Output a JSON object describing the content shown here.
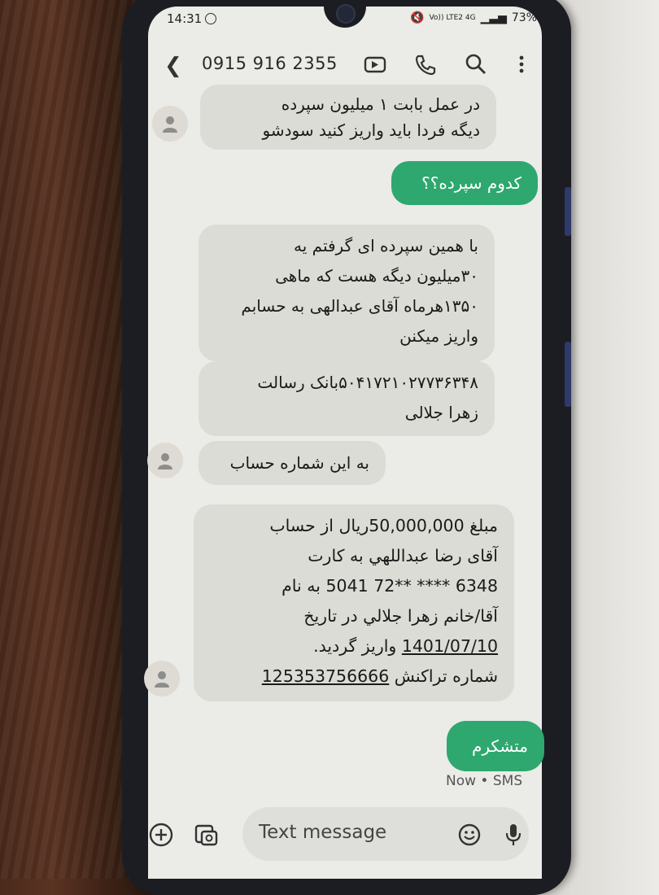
{
  "status_bar": {
    "time": "14:31",
    "network": "Vo)) LTE2 4G",
    "battery": "73%"
  },
  "header": {
    "contact": "0915 916 2355"
  },
  "messages": [
    {
      "direction": "in",
      "text": "در عمل بابت ۱ میلیون سپرده\nدیگه فردا باید واریز کنید سودشو"
    },
    {
      "direction": "out",
      "text": "کدوم سپرده؟؟"
    },
    {
      "direction": "in",
      "text": "با همین سپرده ای گرفتم یه\n۳۰میلیون دیگه هست که ماهی\n۱۳۵۰هرماه آقای عبدالهی به حسابم\nواریز میکنن"
    },
    {
      "direction": "in",
      "text": "۵۰۴۱۷۲۱۰۲۷۷۳۶۳۴۸بانک رسالت\nزهرا جلالی"
    },
    {
      "direction": "in",
      "text": "به این شماره حساب"
    },
    {
      "direction": "in",
      "lines": [
        "مبلغ 50,000,000ریال از حساب",
        "آقای رضا عبداللهي به کارت",
        "6348 **** **72 5041 به نام",
        "آقا/خانم زهرا جلالي در تاريخ",
        "1401/07/10 واريز گرديد.",
        "شماره تراکنش 125353756666"
      ],
      "date": "1401/07/10",
      "transaction": "125353756666"
    },
    {
      "direction": "out",
      "text": "متشکرم"
    }
  ],
  "last_meta": "Now • SMS",
  "compose": {
    "placeholder": "Text message"
  },
  "icons": [
    "back-icon",
    "video-call-icon",
    "phone-icon",
    "search-icon",
    "more-icon",
    "add-icon",
    "gallery-icon",
    "emoji-icon",
    "mic-icon",
    "contact-avatar-icon"
  ]
}
